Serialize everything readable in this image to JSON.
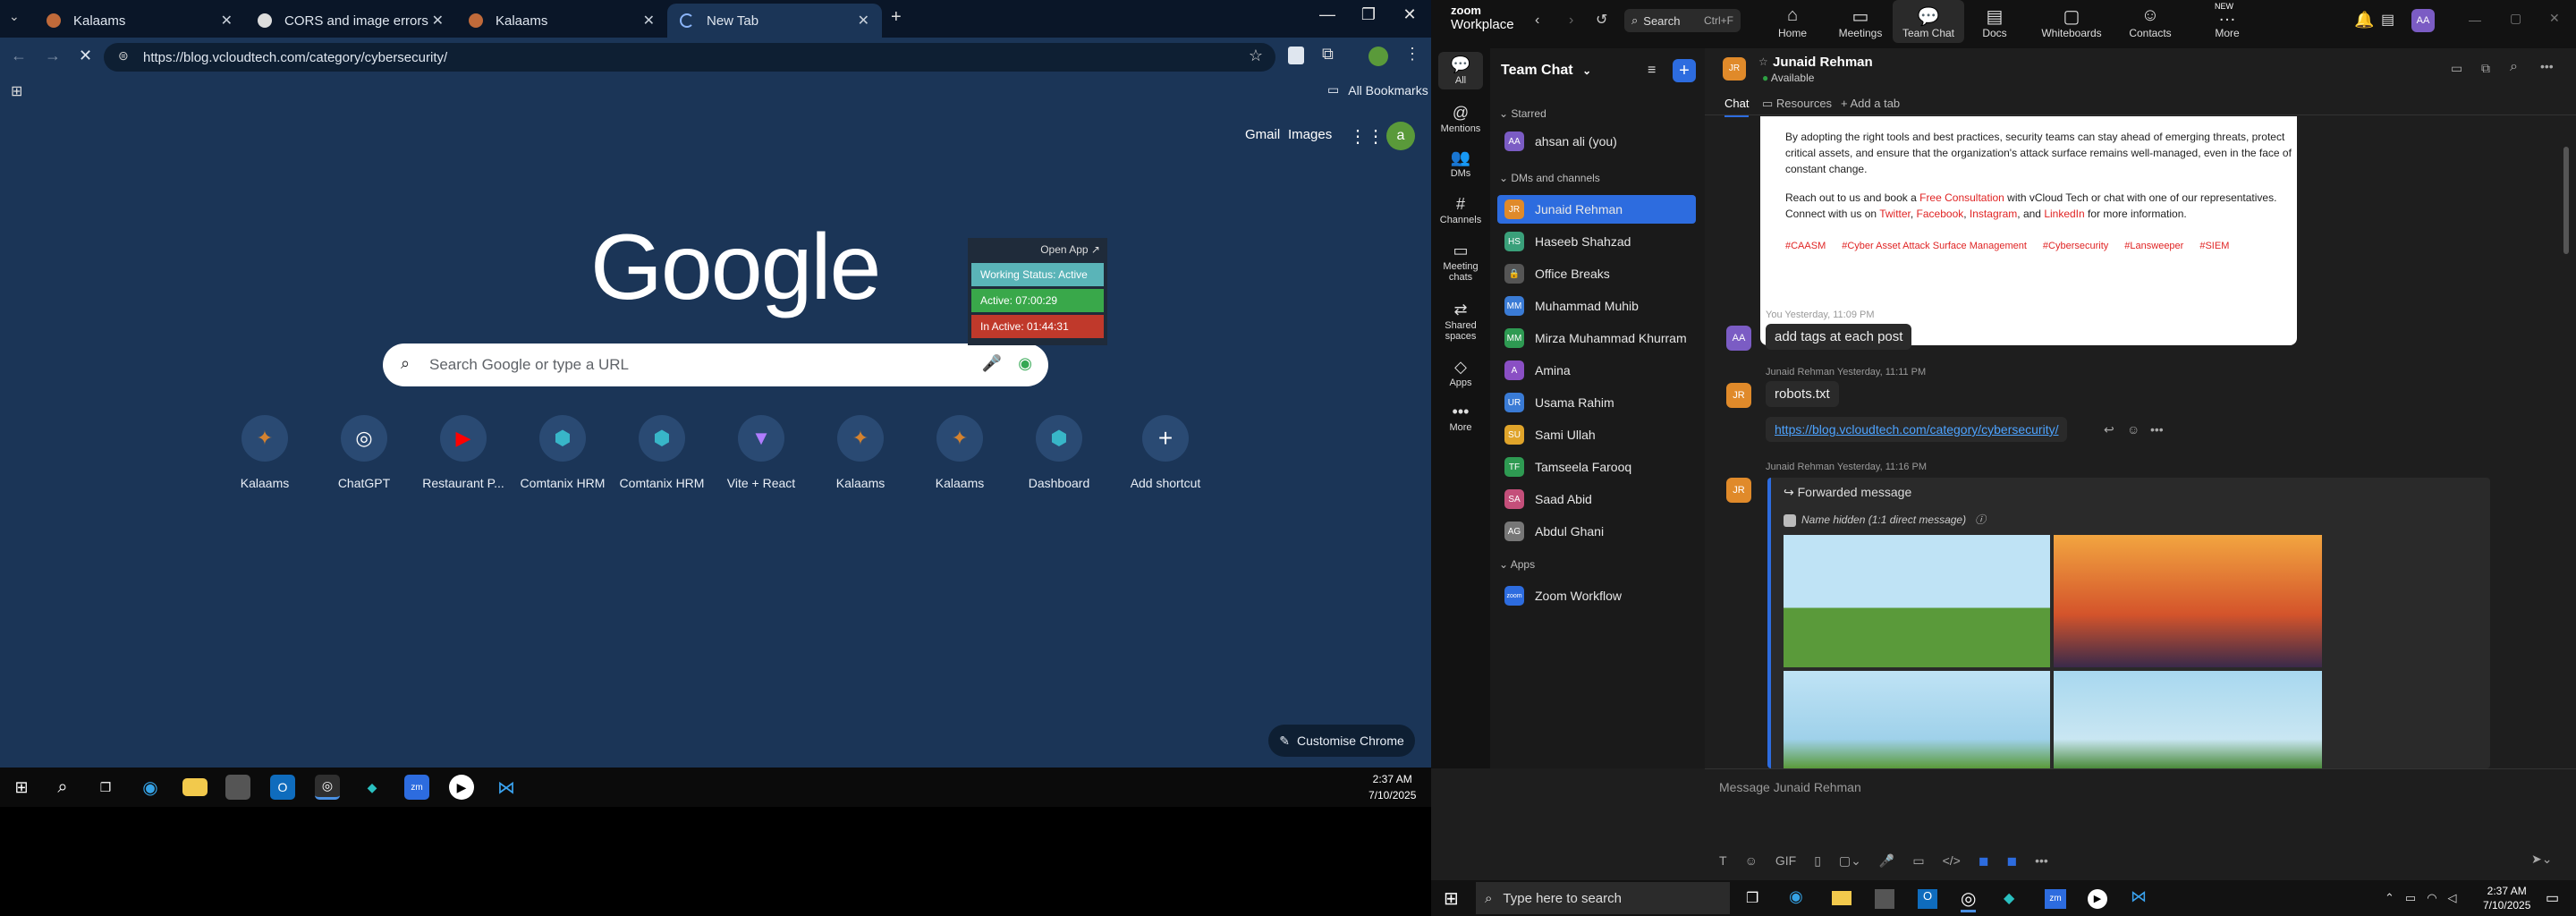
{
  "chrome": {
    "tabs": [
      {
        "label": "Kalaams",
        "active": false
      },
      {
        "label": "CORS and image errors",
        "active": false
      },
      {
        "label": "Kalaams",
        "active": false
      },
      {
        "label": "New Tab",
        "active": true
      }
    ],
    "url": "https://blog.vcloudtech.com/category/cybersecurity/",
    "all_bookmarks": "All Bookmarks",
    "header_links": {
      "gmail": "Gmail",
      "images": "Images",
      "avatar": "a"
    },
    "logo": "Google",
    "search_placeholder": "Search Google or type a URL",
    "shortcuts": [
      {
        "label": "Kalaams",
        "glyph": "✦"
      },
      {
        "label": "ChatGPT",
        "glyph": "◎"
      },
      {
        "label": "Restaurant P...",
        "glyph": "▶"
      },
      {
        "label": "Comtanix HRM",
        "glyph": "⬢"
      },
      {
        "label": "Comtanix HRM",
        "glyph": "⬢"
      },
      {
        "label": "Vite + React",
        "glyph": "▼"
      },
      {
        "label": "Kalaams",
        "glyph": "✦"
      },
      {
        "label": "Kalaams",
        "glyph": "✦"
      },
      {
        "label": "Dashboard",
        "glyph": "⬢"
      },
      {
        "label": "Add shortcut",
        "glyph": "+"
      }
    ],
    "customise": "Customise Chrome",
    "timer": {
      "open_app": "Open App ↗",
      "status": "Working Status: Active",
      "active": "Active: 07:00:29",
      "inactive": "In Active: 01:44:31"
    },
    "clock": {
      "time": "2:37 AM",
      "date": "7/10/2025"
    }
  },
  "zoom": {
    "brand_top": "zoom",
    "brand_bottom": "Workplace",
    "search": "Search",
    "search_shortcut": "Ctrl+F",
    "nav": [
      {
        "label": "Home",
        "icon": "⌂"
      },
      {
        "label": "Meetings",
        "icon": "▭"
      },
      {
        "label": "Team Chat",
        "icon": "💬"
      },
      {
        "label": "Docs",
        "icon": "▤"
      },
      {
        "label": "Whiteboards",
        "icon": "▢"
      },
      {
        "label": "Contacts",
        "icon": "☺"
      },
      {
        "label": "More",
        "icon": "…",
        "badge": "NEW"
      }
    ],
    "user_initials": "AA",
    "rail": [
      {
        "label": "All",
        "icon": "💬"
      },
      {
        "label": "Mentions",
        "icon": "@"
      },
      {
        "label": "DMs",
        "icon": "👥"
      },
      {
        "label": "Channels",
        "icon": "#"
      },
      {
        "label": "Meeting chats",
        "icon": "▭"
      },
      {
        "label": "Shared spaces",
        "icon": "⇄"
      },
      {
        "label": "Apps",
        "icon": "◇"
      },
      {
        "label": "More",
        "icon": "•••"
      }
    ],
    "sidebar": {
      "title": "Team Chat",
      "starred": "Starred",
      "me": {
        "name": "ahsan ali (you)",
        "initials": "AA",
        "color": "#7b5cc4"
      },
      "dms_heading": "DMs and channels",
      "contacts": [
        {
          "name": "Junaid Rehman",
          "initials": "JR",
          "color": "#e08a2a",
          "selected": true
        },
        {
          "name": "Haseeb Shahzad",
          "initials": "HS",
          "color": "#3aa07a"
        },
        {
          "name": "Office Breaks",
          "initials": "🔒",
          "color": "#555"
        },
        {
          "name": "Muhammad Muhib",
          "initials": "MM",
          "color": "#3a7bd5"
        },
        {
          "name": "Mirza Muhammad Khurram",
          "initials": "MM",
          "color": "#2e9a52"
        },
        {
          "name": "Amina",
          "initials": "A",
          "color": "#8a4fc4"
        },
        {
          "name": "Usama Rahim",
          "initials": "UR",
          "color": "#3a7bd5"
        },
        {
          "name": "Sami Ullah",
          "initials": "SU",
          "color": "#e0a42a"
        },
        {
          "name": "Tamseela Farooq",
          "initials": "TF",
          "color": "#2e9a52"
        },
        {
          "name": "Saad Abid",
          "initials": "SA",
          "color": "#c44f7a"
        },
        {
          "name": "Abdul Ghani",
          "initials": "AG",
          "color": "#777"
        }
      ],
      "apps_heading": "Apps",
      "apps": [
        {
          "name": "Zoom Workflow",
          "initials": "zoom",
          "color": "#2d6cdf"
        }
      ]
    },
    "chat": {
      "name": "Junaid Rehman",
      "status": "Available",
      "initials": "JR",
      "tabs": [
        "Chat",
        "Resources",
        "Add a tab"
      ],
      "post_text_1": "By adopting the right tools and best practices, security teams can stay ahead of emerging threats, protect critical assets, and ensure that the organization's attack surface remains well-managed, even in the face of constant change.",
      "post_text_2a": "Reach out to us and book a ",
      "post_link_consult": "Free Consultation",
      "post_text_2b": " with vCloud Tech or chat with one of our representatives. Connect with us on ",
      "post_link_twitter": "Twitter",
      "post_link_facebook": "Facebook",
      "post_link_instagram": "Instagram",
      "post_and": ", and ",
      "post_link_linkedin": "LinkedIn",
      "post_text_2c": " for more information.",
      "post_tags": [
        "#CAASM",
        "#Cyber Asset Attack Surface Management",
        "#Cybersecurity",
        "#Lansweeper",
        "#SIEM"
      ],
      "messages": [
        {
          "meta": "You Yesterday, 11:09 PM",
          "text": "add tags at each post",
          "initials": "AA"
        },
        {
          "meta": "Junaid Rehman Yesterday, 11:11 PM",
          "text": "robots.txt",
          "initials": "JR"
        },
        {
          "link": "https://blog.vcloudtech.com/category/cybersecurity/"
        },
        {
          "meta": "Junaid Rehman Yesterday, 11:16 PM",
          "initials": "JR"
        }
      ],
      "forwarded": "Forwarded message",
      "name_hidden": "Name hidden (1:1 direct message)",
      "composer_placeholder": "Message Junaid Rehman"
    },
    "taskbar": {
      "search_placeholder": "Type here to search",
      "time": "2:37 AM",
      "date": "7/10/2025"
    }
  }
}
